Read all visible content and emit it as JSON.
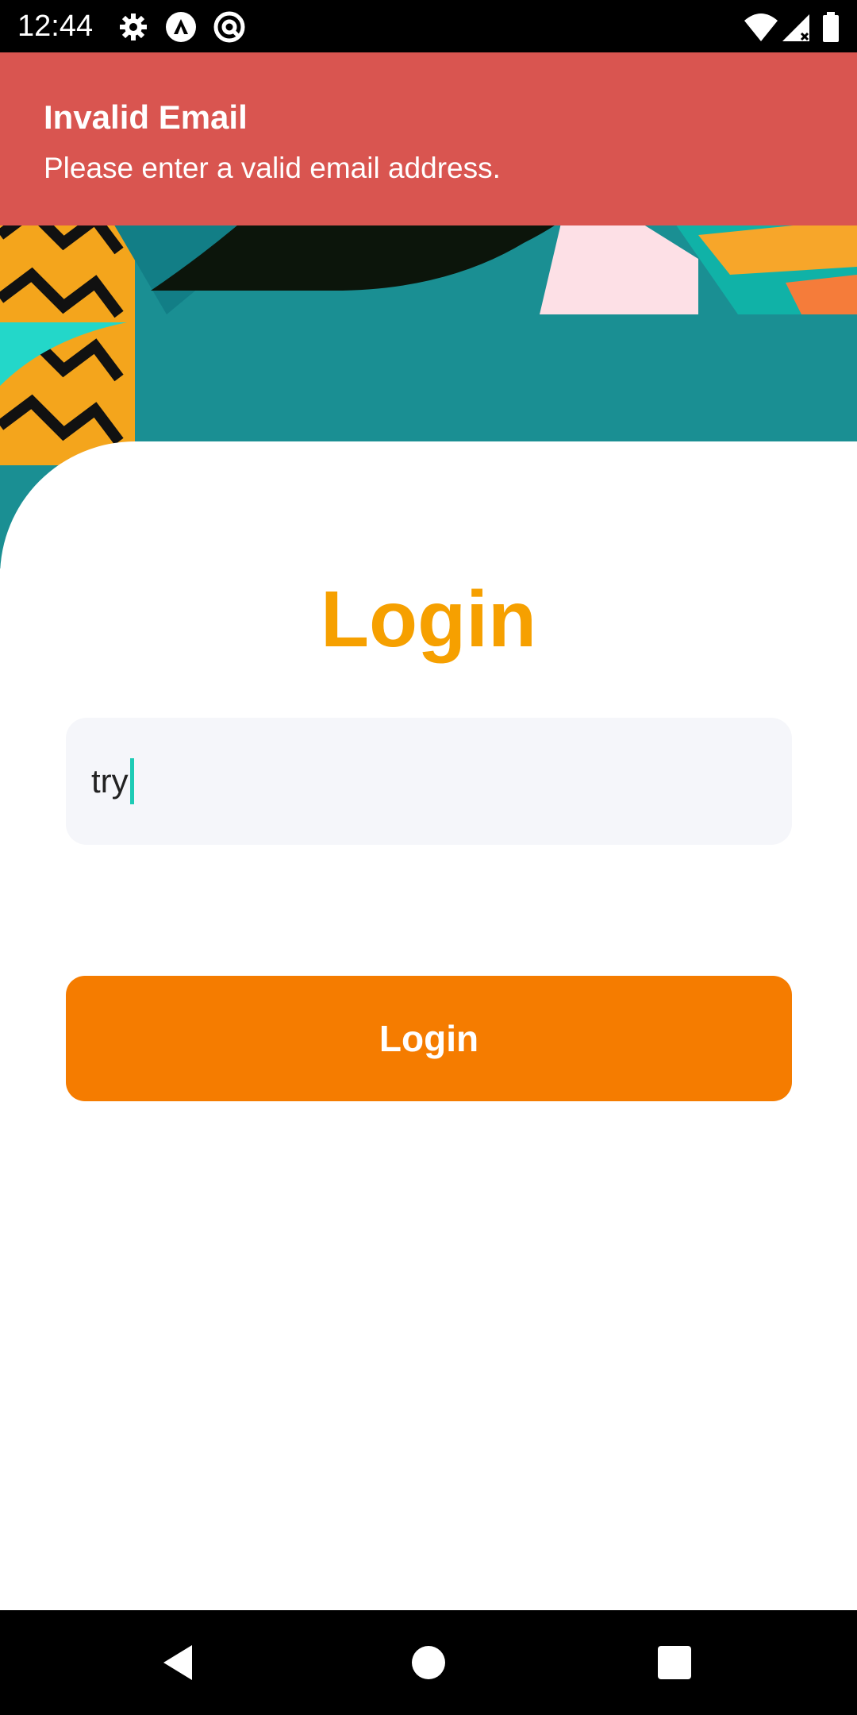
{
  "status_bar": {
    "time": "12:44",
    "left_icons": [
      "gear-icon",
      "app-a-icon",
      "app-at-icon"
    ],
    "right_icons": [
      "wifi-icon",
      "cell-signal-icon",
      "battery-icon"
    ]
  },
  "toast": {
    "title": "Invalid Email",
    "message": "Please enter a valid email address.",
    "background_color": "#d95550"
  },
  "login": {
    "title": "Login",
    "title_color": "#f6a000",
    "email_value": "try",
    "button_label": "Login",
    "button_color": "#f57c00"
  },
  "nav_bar": {
    "buttons": [
      "back-icon",
      "home-icon",
      "recents-icon"
    ]
  }
}
